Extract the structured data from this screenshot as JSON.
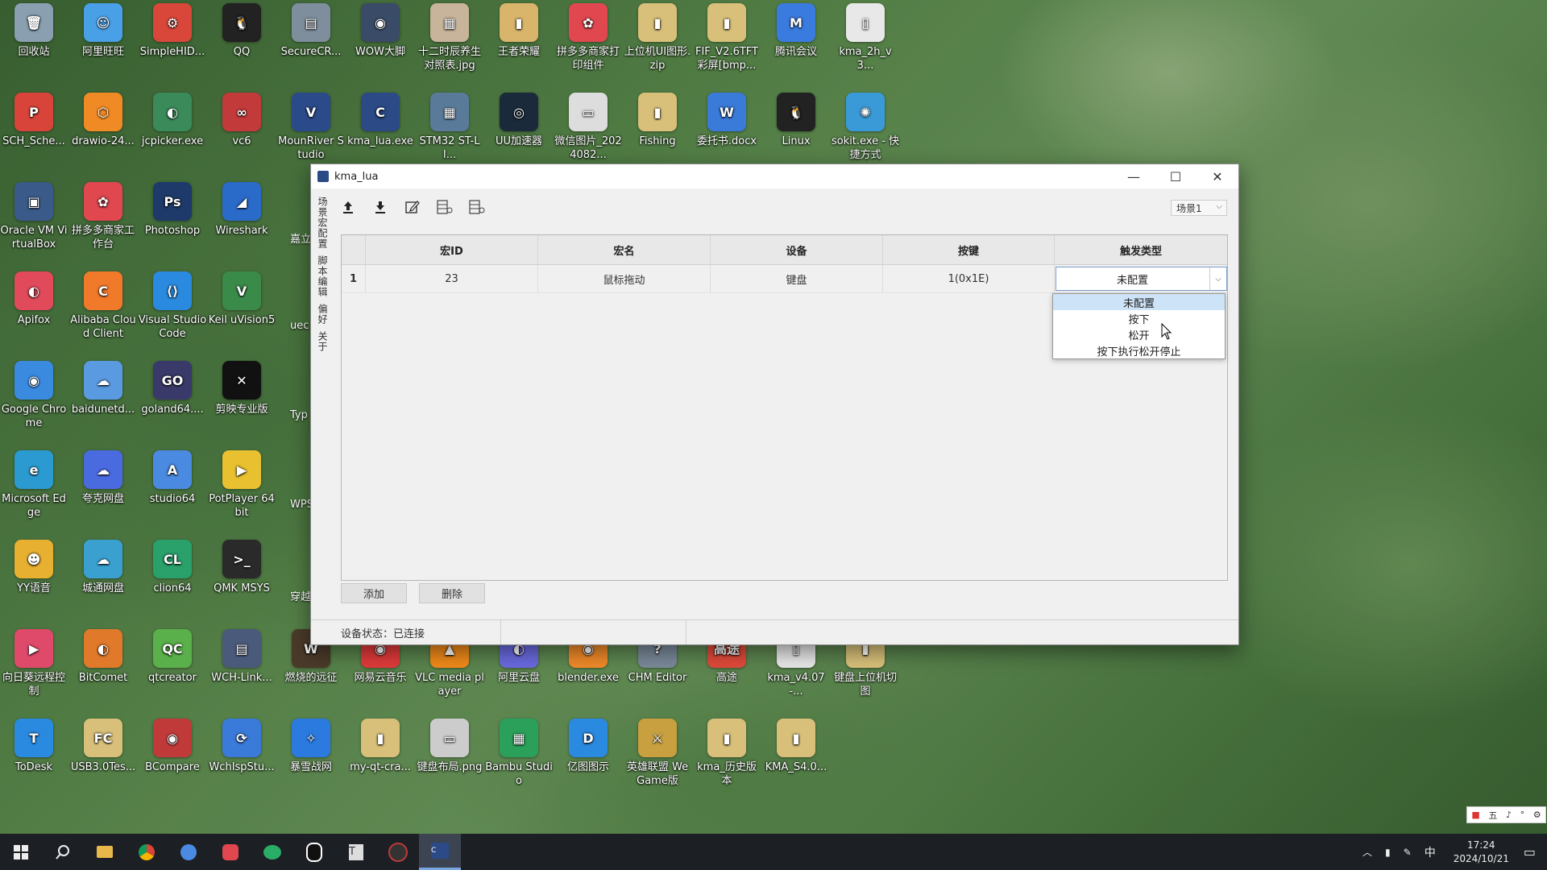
{
  "desktop": {
    "icons": [
      {
        "label": "回收站",
        "color": "#8aa0b0",
        "glyph": "🗑"
      },
      {
        "label": "阿里旺旺",
        "color": "#4aa0e6",
        "glyph": "☺"
      },
      {
        "label": "SimpleHID...",
        "color": "#d9473a",
        "glyph": "⚙"
      },
      {
        "label": "QQ",
        "color": "#222222",
        "glyph": "🐧"
      },
      {
        "label": "SecureCR...",
        "color": "#7e8e9c",
        "glyph": "▤"
      },
      {
        "label": "WOW大脚",
        "color": "#394b66",
        "glyph": "◉"
      },
      {
        "label": "十二时辰养生对照表.jpg",
        "color": "#c8b49a",
        "glyph": "▦"
      },
      {
        "label": "王者荣耀",
        "color": "#d8b56a",
        "glyph": "▮"
      },
      {
        "label": "拼多多商家打印组件",
        "color": "#e0474f",
        "glyph": "✿"
      },
      {
        "label": "上位机UI图形.zip",
        "color": "#d8c07a",
        "glyph": "▮"
      },
      {
        "label": "FIF_V2.6TFT彩屏[bmp...",
        "color": "#d8c07a",
        "glyph": "▮"
      },
      {
        "label": "腾讯会议",
        "color": "#3a7be0",
        "glyph": "M"
      },
      {
        "label": "kma_2h_v3...",
        "color": "#e8e8e8",
        "glyph": "▯"
      },
      {
        "label": "SCH_Sche...",
        "color": "#d8443a",
        "glyph": "P"
      },
      {
        "label": "drawio-24...",
        "color": "#f08a24",
        "glyph": "⬡"
      },
      {
        "label": "jcpicker.exe",
        "color": "#3a8a5a",
        "glyph": "◐"
      },
      {
        "label": "vc6",
        "color": "#c23a3a",
        "glyph": "∞"
      },
      {
        "label": "MounRiver Studio",
        "color": "#2b4a8a",
        "glyph": "V"
      },
      {
        "label": "kma_lua.exe",
        "color": "#2b4a86",
        "glyph": "C"
      },
      {
        "label": "STM32 ST-LI...",
        "color": "#5a7a9a",
        "glyph": "▦"
      },
      {
        "label": "UU加速器",
        "color": "#1a2a3a",
        "glyph": "◎"
      },
      {
        "label": "微信图片_2024082...",
        "color": "#dddddd",
        "glyph": "▭"
      },
      {
        "label": "Fishing",
        "color": "#d8c07a",
        "glyph": "▮"
      },
      {
        "label": "委托书.docx",
        "color": "#3a7ad8",
        "glyph": "W"
      },
      {
        "label": "Linux",
        "color": "#222222",
        "glyph": "🐧"
      },
      {
        "label": "sokit.exe - 快捷方式",
        "color": "#3a9ad8",
        "glyph": "✺"
      },
      {
        "label": "Oracle VM VirtualBox",
        "color": "#3a5a8a",
        "glyph": "▣"
      },
      {
        "label": "拼多多商家工作台",
        "color": "#e0474f",
        "glyph": "✿"
      },
      {
        "label": "Photoshop",
        "color": "#1d3a6a",
        "glyph": "Ps"
      },
      {
        "label": "Wireshark",
        "color": "#2a6ac8",
        "glyph": "◢"
      },
      {
        "label": "Apifox",
        "color": "#e04a5a",
        "glyph": "◐"
      },
      {
        "label": "Alibaba Cloud Client",
        "color": "#f07a2a",
        "glyph": "C"
      },
      {
        "label": "Visual Studio Code",
        "color": "#2a8ae0",
        "glyph": "⟨⟩"
      },
      {
        "label": "Keil uVision5",
        "color": "#3a8a4a",
        "glyph": "V"
      },
      {
        "label": "Google Chrome",
        "color": "#3a8ae0",
        "glyph": "◉"
      },
      {
        "label": "baidunetd...",
        "color": "#5a9ae0",
        "glyph": "☁"
      },
      {
        "label": "goland64....",
        "color": "#3a3a6a",
        "glyph": "GO"
      },
      {
        "label": "剪映专业版",
        "color": "#111111",
        "glyph": "✕"
      },
      {
        "label": "Microsoft Edge",
        "color": "#2a9ad0",
        "glyph": "e"
      },
      {
        "label": "夸克网盘",
        "color": "#4a6ae0",
        "glyph": "☁"
      },
      {
        "label": "studio64",
        "color": "#4a8ae0",
        "glyph": "A"
      },
      {
        "label": "PotPlayer 64 bit",
        "color": "#e8c030",
        "glyph": "▶"
      },
      {
        "label": "YY语音",
        "color": "#e8b030",
        "glyph": "☻"
      },
      {
        "label": "城通网盘",
        "color": "#3aa0d0",
        "glyph": "☁"
      },
      {
        "label": "clion64",
        "color": "#2aa06a",
        "glyph": "CL"
      },
      {
        "label": "QMK MSYS",
        "color": "#2a2a2a",
        "glyph": ">_"
      },
      {
        "label": "向日葵远程控制",
        "color": "#e04a6a",
        "glyph": "▶"
      },
      {
        "label": "BitComet",
        "color": "#e07a2a",
        "glyph": "◐"
      },
      {
        "label": "qtcreator",
        "color": "#5ab04a",
        "glyph": "QC"
      },
      {
        "label": "WCH-Link...",
        "color": "#4a5a7a",
        "glyph": "▤"
      },
      {
        "label": "ToDesk",
        "color": "#2a8ae0",
        "glyph": "T"
      },
      {
        "label": "USB3.0Tes...",
        "color": "#d8c07a",
        "glyph": "FC"
      },
      {
        "label": "BCompare",
        "color": "#c03a3a",
        "glyph": "◉"
      },
      {
        "label": "WchIspStu...",
        "color": "#3a7ad8",
        "glyph": "⟳"
      }
    ],
    "icons_row2": [
      {
        "label": "燃烧的远征",
        "color": "#4a3a2a",
        "glyph": "W"
      },
      {
        "label": "网易云音乐",
        "color": "#e03a3a",
        "glyph": "◉"
      },
      {
        "label": "VLC media player",
        "color": "#f08a1a",
        "glyph": "▲"
      },
      {
        "label": "阿里云盘",
        "color": "#6a6ae0",
        "glyph": "◐"
      },
      {
        "label": "blender.exe",
        "color": "#f08a2a",
        "glyph": "◉"
      },
      {
        "label": "CHM Editor",
        "color": "#7a8a9a",
        "glyph": "?"
      },
      {
        "label": "高途",
        "color": "#e04a3a",
        "glyph": "高途"
      },
      {
        "label": "kma_v4.07-...",
        "color": "#e8e8e8",
        "glyph": "▯"
      },
      {
        "label": "键盘上位机切图",
        "color": "#d8c07a",
        "glyph": "▮"
      },
      {
        "label": "暴雪战网",
        "color": "#2a7ae0",
        "glyph": "✧"
      },
      {
        "label": "my-qt-cra...",
        "color": "#d8c07a",
        "glyph": "▮"
      },
      {
        "label": "键盘布局.png",
        "color": "#cccccc",
        "glyph": "▭"
      },
      {
        "label": "Bambu Studio",
        "color": "#2aa05a",
        "glyph": "▦"
      },
      {
        "label": "亿图图示",
        "color": "#2a8ae0",
        "glyph": "D"
      },
      {
        "label": "英雄联盟 WeGame版",
        "color": "#c8a040",
        "glyph": "⚔"
      },
      {
        "label": "kma_历史版本",
        "color": "#d8c07a",
        "glyph": "▮"
      },
      {
        "label": "KMA_S4.0...",
        "color": "#d8c07a",
        "glyph": "▮"
      }
    ],
    "partial_labels": [
      "嘉立创",
      "uec",
      "Typ",
      "WPS",
      "穿越"
    ]
  },
  "window": {
    "title": "kma_lua",
    "minimize": "—",
    "maximize": "☐",
    "close": "✕",
    "scene_select": "场景1",
    "side_tabs": [
      "场景宏配置",
      "脚本编辑",
      "偏好",
      "关于"
    ],
    "table": {
      "headers": [
        "宏ID",
        "宏名",
        "设备",
        "按键",
        "触发类型"
      ],
      "rows": [
        {
          "num": "1",
          "id": "23",
          "name": "鼠标拖动",
          "device": "键盘",
          "key": "1(0x1E)",
          "trigger": "未配置"
        }
      ]
    },
    "dropdown_options": [
      "未配置",
      "按下",
      "松开",
      "按下执行松开停止"
    ],
    "add_button": "添加",
    "delete_button": "删除",
    "status": "设备状态：已连接"
  },
  "taskbar": {
    "time": "17:24",
    "date": "2024/10/21",
    "ime": "中",
    "ime_bar": [
      "五",
      "♪",
      "°",
      "⚙"
    ]
  }
}
